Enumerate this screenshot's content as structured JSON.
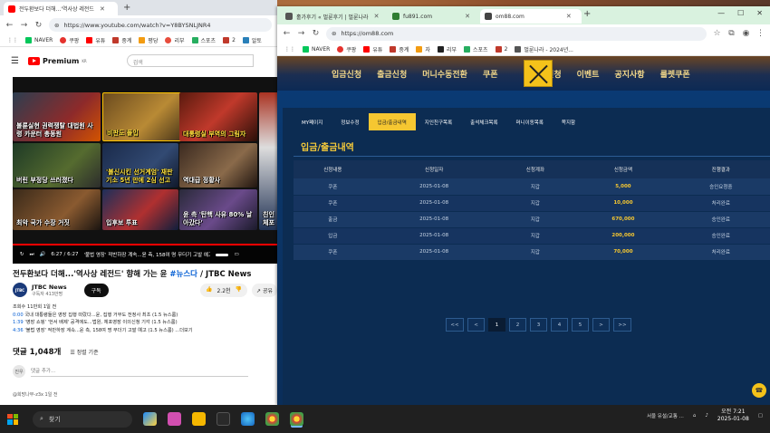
{
  "left_browser": {
    "tabs": [
      {
        "label": "전두환보다 더해...'역사상 레전드"
      },
      {
        "label": ""
      }
    ],
    "url": "https://www.youtube.com/watch?v=Y8BYSNLJNR4",
    "bookmarks": [
      "NAVER",
      "쿠팡",
      "유튜",
      "중계",
      "평당",
      "리부",
      "스포츠",
      "2",
      "알토"
    ],
    "youtube": {
      "logo": "Premium",
      "logo_sup": "KR",
      "search_placeholder": "검색",
      "cards": [
        "불륜실현 권력쟁탈 대법원 사령 카운터 총동원",
        "비판도 돌입",
        "대통령실 부역의 그림자",
        "버린 부정당 쓰러졌다",
        "'불신시킨 선거계엄' 재판 기소 5년 만에 2심 선고",
        "역대급 정황사",
        "윤 측 '탄핵 사유 80% 날아갔다'",
        "친인 체포",
        "최악 국가 수장 거짓",
        "입후보 투표"
      ],
      "time": "6:27 / 6:27",
      "chapter": "'불법 영장' 적반하장 계속...윤 측, 158여 명 무더기 고발 예고 ›",
      "title_main": "전두환보다 더해...'역사상 레전드' 향해 가는 윤",
      "title_tag": "#뉴스다",
      "title_suffix": "/ JTBC News",
      "channel": "JTBC News",
      "subscribers": "구독자 413만명",
      "subscribe": "구독",
      "likes": "2.2천",
      "share": "공유",
      "desc": [
        {
          "ts": "",
          "text": "조회수 11만회 1일 전"
        },
        {
          "ts": "0:00",
          "text": "국내 대통령들은 영장 집행 따랐다...윤, 집행 거부도 전정사 최초 (1.5 뉴스룸)"
        },
        {
          "ts": "1:39",
          "text": "'영장 쇼핑' '헌서 배제' 공격에도...법원, 체포영장 이의신청 기각 (1.5 뉴스룸)"
        },
        {
          "ts": "4:36",
          "text": "'불법 영장' 적반하장 계속...윤 측, 158여 명 무더기 고발 예고 (1.5 뉴스룸) ...더보기"
        }
      ],
      "comments_count": "댓글 1,048개",
      "sort": "정렬 기준",
      "comment_avatar": "진우",
      "comment_placeholder": "댓글 추가...",
      "comment_peek": "@희망나무-z3x 1일 전"
    }
  },
  "right_browser": {
    "tabs": [
      {
        "label": "홀가후기 « 벌룬후기 | 벌룬나라"
      },
      {
        "label": "fu891.com"
      },
      {
        "label": "om88.com"
      }
    ],
    "url": "https://om88.com",
    "bookmarks": [
      "NAVER",
      "쿠팡",
      "유튜",
      "중계",
      "자",
      "리부",
      "스포츠",
      "2",
      "벌룬나라 - 2024년..."
    ],
    "site": {
      "nav": [
        "입금신청",
        "출금신청",
        "머니수동전환",
        "쿠폰",
        "콤프신청",
        "이벤트",
        "공지사항",
        "룰렛쿠폰"
      ],
      "subtabs": [
        "MY페이지",
        "정보수정",
        "입금/출금내역",
        "지인친구목록",
        "출석체크목록",
        "머니이동목록",
        "쪽지함"
      ],
      "active_subtab": 2,
      "panel_title": "입금/출금내역",
      "table": {
        "headers": [
          "신청내용",
          "신청일자",
          "신청계좌",
          "신청금액",
          "진행결과"
        ],
        "rows": [
          [
            "쿠폰",
            "2025-01-08",
            "지갑",
            "5,000",
            "승인요청중"
          ],
          [
            "쿠폰",
            "2025-01-08",
            "지갑",
            "10,000",
            "처리완료"
          ],
          [
            "출금",
            "2025-01-08",
            "지갑",
            "670,000",
            "승인완료"
          ],
          [
            "입금",
            "2025-01-08",
            "지갑",
            "200,000",
            "승인완료"
          ],
          [
            "쿠폰",
            "2025-01-08",
            "지갑",
            "70,000",
            "처리완료"
          ]
        ]
      },
      "pagination": [
        "<<",
        "<",
        "1",
        "2",
        "3",
        "4",
        "5",
        ">",
        ">>"
      ],
      "current_page": "1"
    }
  },
  "taskbar": {
    "search": "찾기",
    "tray_text": "서울 유설/교통 ...",
    "time": "오전 7:21",
    "date": "2025-01-08"
  }
}
